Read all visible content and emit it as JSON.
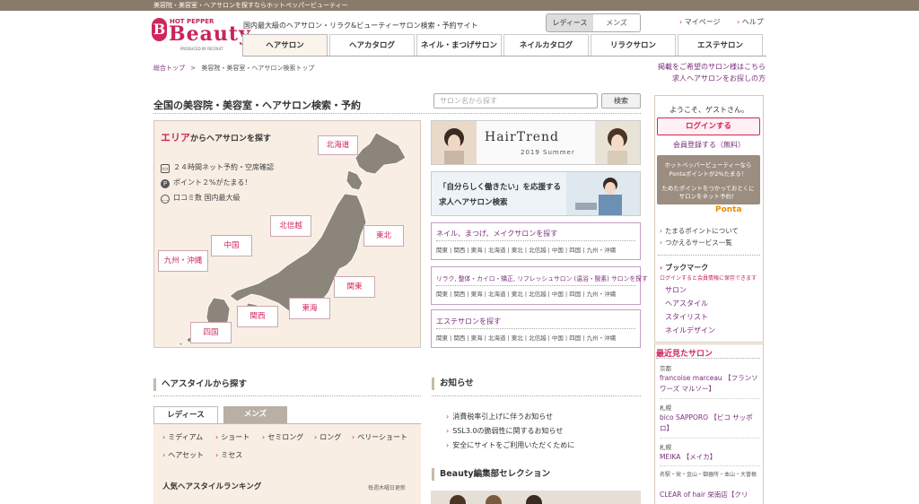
{
  "topbar": {
    "text": "美容院・美容室・ヘアサロンを探すならホットペッパービューティー"
  },
  "logo": {
    "badge": "B",
    "top": "HOT PEPPER",
    "word": "Beauty",
    "by": "PRODUCED BY RECRUIT"
  },
  "header": {
    "tagline": "国内最大級のヘアサロン・リラク&ビューティーサロン検索・予約サイト",
    "gender": {
      "ladies": "レディース",
      "mens": "メンズ"
    },
    "mypage": "マイページ",
    "help": "ヘルプ"
  },
  "nav": {
    "tabs": [
      "ヘアサロン",
      "ヘアカタログ",
      "ネイル・まつげサロン",
      "ネイルカタログ",
      "リラクサロン",
      "エステサロン"
    ],
    "active": "ヘアサロン"
  },
  "breadcrumb": {
    "home": "総合トップ",
    "sep": ">",
    "current": "美容院・美容室・ヘアサロン検索トップ"
  },
  "rightlinks": {
    "listing": "掲載をご希望のサロン様はこちら",
    "jobs": "求人ヘアサロンをお探しの方"
  },
  "main": {
    "title": "全国の美容院・美容室・ヘアサロン検索・予約",
    "search": {
      "placeholder": "サロン名から探す",
      "button": "検索"
    }
  },
  "area": {
    "title_em": "エリア",
    "title_rest": "からヘアサロンを探す",
    "features": [
      "２４時間ネット予約・空席確認",
      "ポイント２%がたまる！",
      "口コミ数 国内最大級"
    ],
    "feature_icons": [
      "monitor-icon",
      "point-icon",
      "speech-bubble-icon"
    ],
    "regions": {
      "hokkaido": "北海道",
      "tohoku": "東北",
      "hokushinetsu": "北信越",
      "kanto": "関東",
      "tokai": "東海",
      "kansai": "関西",
      "chugoku": "中国",
      "shikoku": "四国",
      "kyushu": "九州・沖縄"
    }
  },
  "banners": {
    "hairtrend": {
      "title": "HairTrend",
      "sub": "2019 Summer"
    },
    "jobs": {
      "line1": "「自分らしく働きたい」を応援する",
      "line2": "求人ヘアサロン検索"
    }
  },
  "recommend": {
    "nail": {
      "title": "ネイル、まつげ、メイクサロンを探す",
      "links": "関東 | 関西 | 東海 | 北海道 | 東北 | 北信越 | 中国 | 四国 | 九州・沖縄"
    },
    "relax": {
      "title": "リラク, 整体・カイロ・矯正, リフレッシュサロン (温浴・酸素) サロンを探す",
      "links": "関東 | 関西 | 東海 | 北海道 | 東北 | 北信越 | 中国 | 四国 | 九州・沖縄"
    },
    "esthe": {
      "title": "エステサロンを探す",
      "links": "関東 | 関西 | 東海 | 北海道 | 東北 | 北信越 | 中国 | 四国 | 九州・沖縄"
    }
  },
  "hairstyle": {
    "title": "ヘアスタイルから探す",
    "tabs": {
      "ladies": "レディース",
      "mens": "メンズ"
    },
    "links": [
      "ミディアム",
      "ショート",
      "セミロング",
      "ロング",
      "ベリーショート",
      "ヘアセット",
      "ミセス"
    ],
    "ranking_title": "人気ヘアスタイルランキング",
    "ranking_note": "毎週木曜日更新"
  },
  "news": {
    "title": "お知らせ",
    "items": [
      "消費税率引上げに伴うお知らせ",
      "SSL3.0の脆弱性に関するお知らせ",
      "安全にサイトをご利用いただくために"
    ]
  },
  "editorial": {
    "title": "Beauty編集部セレクション"
  },
  "sidebar": {
    "welcome": "ようこそ、ゲストさん。",
    "login": "ログインする",
    "signup": "会員登録する（無料）",
    "ponta": {
      "line1": "ホットペッパービューティーなら",
      "line2": "Pontaポイントが2%たまる！",
      "line3": "ためたポイントをつかっておとくに",
      "line4": "サロンをネット予約！",
      "logo": "Ponta"
    },
    "links": [
      "たまるポイントについて",
      "つかえるサービス一覧"
    ],
    "bookmark": {
      "title": "ブックマーク",
      "note": "ログインすると会員情報に保存できます",
      "items": [
        "サロン",
        "ヘアスタイル",
        "スタイリスト",
        "ネイルデザイン"
      ]
    },
    "recent": {
      "title": "最近見たサロン",
      "items": [
        {
          "area": "京都",
          "name": "francoise marceau 【フランソワーズ マルソー】"
        },
        {
          "area": "札幌",
          "name": "bico SAPPORO 【ビコ サッポロ】"
        },
        {
          "area": "札幌",
          "name": "MEIKA 【メイカ】"
        },
        {
          "area": "名駅・栄・金山・御器所・本山・大曽根",
          "name": "CLEAR of hair 栄南店【クリ"
        }
      ]
    }
  }
}
